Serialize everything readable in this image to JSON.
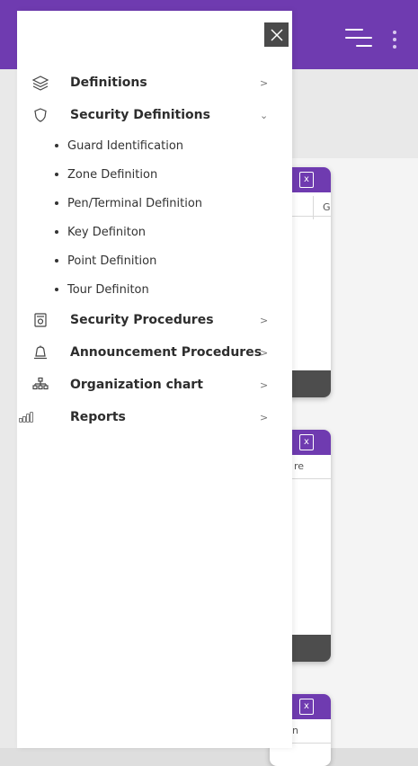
{
  "menu": {
    "definitions": "Definitions",
    "security_definitions": "Security Definitions",
    "security_sub": [
      "Guard Identification",
      "Zone Definition",
      "Pen/Terminal Definition",
      "Key Definiton",
      "Point Definition",
      "Tour Definiton"
    ],
    "security_procedures": "Security Procedures",
    "announcement_procedures": "Announcement Procedures",
    "organization_chart": "Organization chart",
    "reports": "Reports",
    "chevron_right": ">",
    "chevron_down": "⌄"
  },
  "background": {
    "card1_col2": "G",
    "card2_col": "re",
    "card3_col": "n",
    "xls_glyph": "x"
  },
  "icons": {
    "close": "close-icon",
    "definitions": "layers-icon",
    "security": "shield-icon",
    "procedures": "document-icon",
    "announcement": "bell-icon",
    "org": "org-chart-icon",
    "reports": "bar-chart-icon"
  },
  "colors": {
    "header": "#6f3bb0",
    "close_bg": "#4a4a4a",
    "card_footer": "#4d4d4d"
  }
}
